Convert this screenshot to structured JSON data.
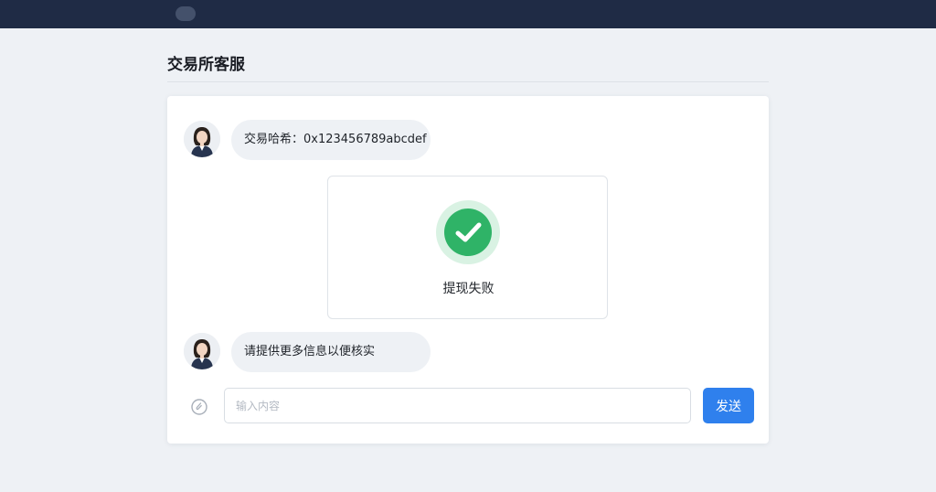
{
  "app": {
    "page_title": "交易所客服"
  },
  "chat": {
    "messages": [
      {
        "sender": "agent",
        "avatar_icon": "agent-avatar-icon",
        "text": "交易哈希：0x123456789abcdef"
      },
      {
        "sender": "agent",
        "avatar_icon": "agent-avatar-icon",
        "text": "请提供更多信息以便核实"
      }
    ],
    "status_card": {
      "icon": "check-circle-icon",
      "text": "提现失败",
      "icon_color": "#2fb367"
    }
  },
  "composer": {
    "placeholder": "输入内容",
    "value": "",
    "send_label": "发送",
    "attach_icon": "attachment-icon",
    "send_color": "#2f80ed"
  }
}
